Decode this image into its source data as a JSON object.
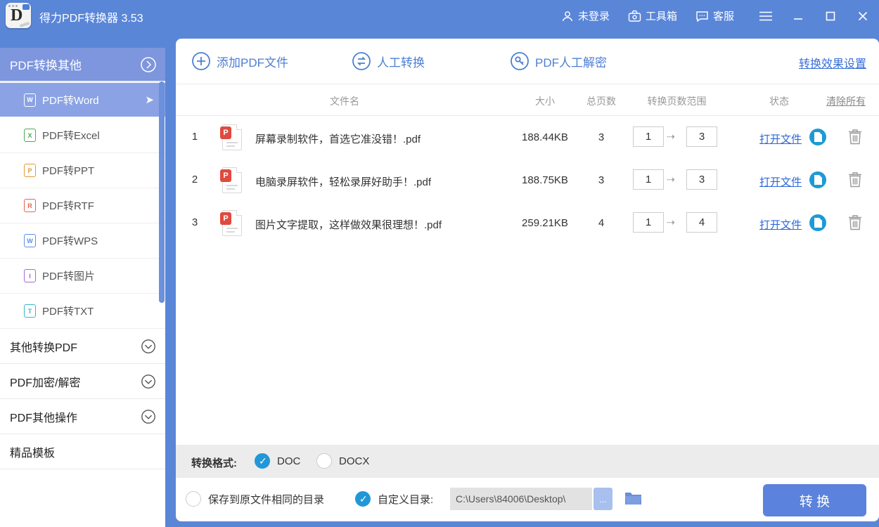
{
  "window": {
    "title": "得力PDF转换器 3.53",
    "app_letter": "D",
    "user": "未登录",
    "toolbox": "工具箱",
    "service": "客服"
  },
  "sidebar": {
    "header": "PDF转换其他",
    "items": [
      {
        "label": "PDF转Word",
        "letter": "W",
        "selected": true
      },
      {
        "label": "PDF转Excel",
        "letter": "X"
      },
      {
        "label": "PDF转PPT",
        "letter": "P"
      },
      {
        "label": "PDF转RTF",
        "letter": "R"
      },
      {
        "label": "PDF转WPS",
        "letter": "W"
      },
      {
        "label": "PDF转图片",
        "letter": "I"
      },
      {
        "label": "PDF转TXT",
        "letter": "T"
      }
    ],
    "sections": [
      {
        "label": "其他转换PDF"
      },
      {
        "label": "PDF加密/解密"
      },
      {
        "label": "PDF其他操作"
      }
    ],
    "template_label": "精品模板"
  },
  "toolbar": {
    "add_label": "添加PDF文件",
    "manual_label": "人工转换",
    "decrypt_label": "PDF人工解密",
    "settings_label": "转换效果设置"
  },
  "table": {
    "headers": {
      "name": "文件名",
      "size": "大小",
      "pages": "总页数",
      "range": "转换页数范围",
      "status": "状态",
      "clear_all": "清除所有"
    },
    "rows": [
      {
        "index": "1",
        "name": "屏幕录制软件，首选它准没错！.pdf",
        "size": "188.44KB",
        "pages": "3",
        "from": "1",
        "to": "3",
        "status": "打开文件"
      },
      {
        "index": "2",
        "name": "电脑录屏软件，轻松录屏好助手！.pdf",
        "size": "188.75KB",
        "pages": "3",
        "from": "1",
        "to": "3",
        "status": "打开文件"
      },
      {
        "index": "3",
        "name": "图片文字提取，这样做效果很理想！.pdf",
        "size": "259.21KB",
        "pages": "4",
        "from": "1",
        "to": "4",
        "status": "打开文件"
      }
    ]
  },
  "format": {
    "label": "转换格式:",
    "doc_label": "DOC",
    "docx_label": "DOCX"
  },
  "output": {
    "save_same_label": "保存到原文件相同的目录",
    "custom_label": "自定义目录:",
    "path": "C:\\Users\\84006\\Desktop\\",
    "browse_label": "...",
    "convert_label": "转 换"
  },
  "icons": {
    "pdf_badge": "P",
    "range_arrow": "⇢",
    "selected_arrow": "➤"
  },
  "colors": {
    "titlebar": "#5a86d8",
    "sidebar_header": "#7d96dd",
    "selected_item": "#8ba3e4",
    "accent_blue": "#4d7fd3",
    "link_blue": "#2e68d9",
    "checked_radio": "#2297d8",
    "status_circle": "#1d9ad6",
    "convert_button": "#5b82dc",
    "format_bar": "#ececec"
  }
}
